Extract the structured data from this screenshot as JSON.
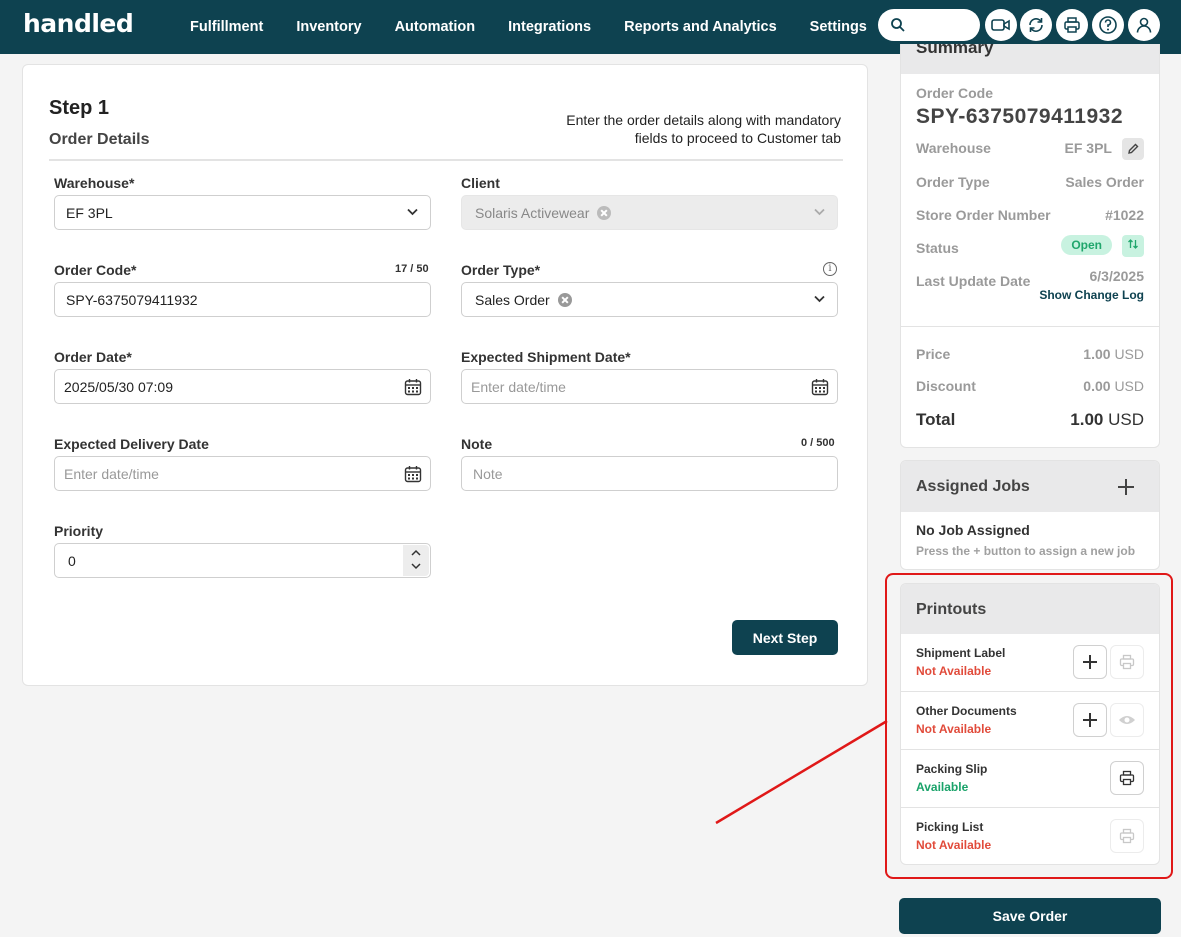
{
  "header": {
    "logo": "handled",
    "nav": [
      "Fulfillment",
      "Inventory",
      "Automation",
      "Integrations",
      "Reports and Analytics",
      "Settings"
    ],
    "icons": [
      "search-icon",
      "video-icon",
      "refresh-icon",
      "print-icon",
      "help-icon",
      "user-icon"
    ]
  },
  "form": {
    "step": "Step 1",
    "title": "Order Details",
    "instruction_line1": "Enter the order details along with mandatory",
    "instruction_line2": "fields to proceed to Customer tab",
    "warehouse": {
      "label": "Warehouse*",
      "value": "EF 3PL"
    },
    "client": {
      "label": "Client",
      "value": "Solaris Activewear"
    },
    "order_code": {
      "label": "Order Code*",
      "value": "SPY-6375079411932",
      "counter": "17 / 50"
    },
    "order_type": {
      "label": "Order Type*",
      "value": "Sales Order"
    },
    "order_date": {
      "label": "Order Date*",
      "value": "2025/05/30 07:09"
    },
    "expected_shipment_date": {
      "label": "Expected Shipment Date*",
      "placeholder": "Enter date/time"
    },
    "expected_delivery_date": {
      "label": "Expected Delivery Date",
      "placeholder": "Enter date/time"
    },
    "note": {
      "label": "Note",
      "placeholder": "Note",
      "counter": "0 / 500"
    },
    "priority": {
      "label": "Priority",
      "value": "0"
    },
    "next_button": "Next Step"
  },
  "summary": {
    "title": "Summary",
    "order_code_label": "Order Code",
    "order_code": "SPY-6375079411932",
    "warehouse_label": "Warehouse",
    "warehouse": "EF 3PL",
    "order_type_label": "Order Type",
    "order_type": "Sales Order",
    "store_order_label": "Store Order Number",
    "store_order": "#1022",
    "status_label": "Status",
    "status": "Open",
    "last_update_label": "Last Update Date",
    "last_update": "6/3/2025",
    "change_log": "Show Change Log",
    "price_label": "Price",
    "price": "1.00",
    "discount_label": "Discount",
    "discount": "0.00",
    "total_label": "Total",
    "total": "1.00",
    "currency": "USD"
  },
  "jobs": {
    "title": "Assigned Jobs",
    "empty_title": "No Job Assigned",
    "empty_hint": "Press the + button to assign a new job"
  },
  "printouts": {
    "title": "Printouts",
    "items": [
      {
        "name": "Shipment Label",
        "status": "Not Available"
      },
      {
        "name": "Other Documents",
        "status": "Not Available"
      },
      {
        "name": "Packing Slip",
        "status": "Available"
      },
      {
        "name": "Picking List",
        "status": "Not Available"
      }
    ]
  },
  "save_button": "Save Order",
  "colors": {
    "brand": "#0e4250",
    "available": "#1aa36a",
    "not_available": "#e14b3b",
    "annotation": "#e01818"
  }
}
